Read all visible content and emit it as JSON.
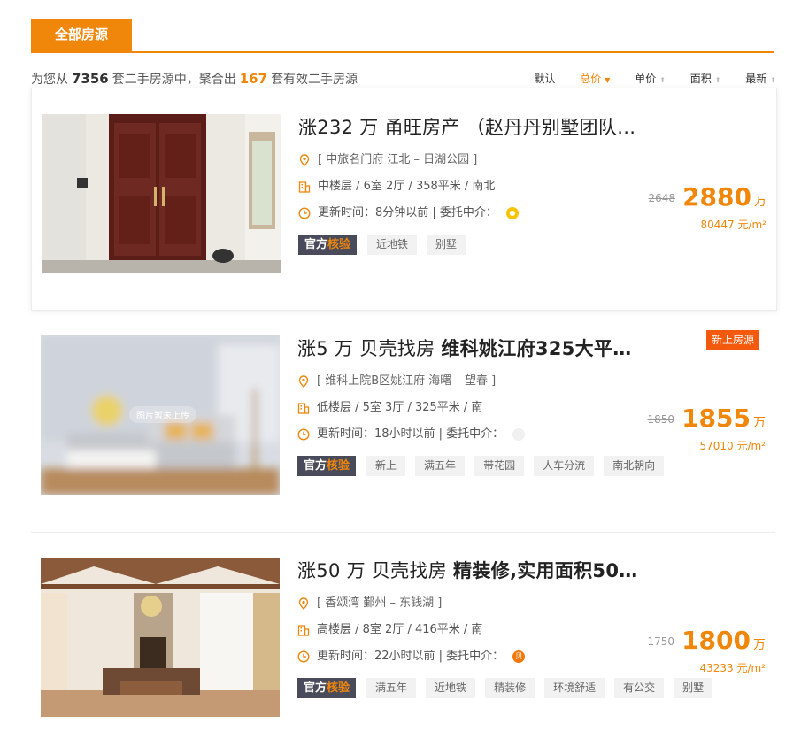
{
  "tabs": {
    "active": "全部房源"
  },
  "summary": {
    "prefix": "为您从",
    "total": "7356",
    "mid": "套二手房源中，聚合出",
    "matched": "167",
    "suffix": "套有效二手房源"
  },
  "sorts": [
    "默认",
    "总价",
    "单价",
    "面积",
    "最新"
  ],
  "colors": {
    "accent": "#f0870b",
    "new_badge": "#f35a0d"
  },
  "listings": [
    {
      "title_prefix": "涨232 万  甬旺房产 ",
      "title_main": "（赵丹丹别墅团队…",
      "address": "[ 中旅名门府 江北 – 日湖公园 ]",
      "specs": "中楼层 / 6室 2厅 / 358平米 / 南北",
      "updated": "更新时间：8分钟以前 | 委托中介：",
      "agent_icon": "yellow-agent-icon",
      "badge_pre": "官方",
      "badge_post": "核验",
      "tags": [
        "近地铁",
        "别墅"
      ],
      "old_price": "2648",
      "price": "2880",
      "unit": "万",
      "per_sqm": "80447 元/m²"
    },
    {
      "title_prefix": "涨5 万  贝壳找房 ",
      "title_main": "维科姚江府325大平…",
      "new_label": "新上房源",
      "address": "[ 维科上院B区姚江府 海曙 – 望春 ]",
      "specs": "低楼层 / 5室 3厅 / 325平米 / 南",
      "updated": "更新时间：18小时以前 | 委托中介：",
      "photo_note": "图片暂未上传",
      "badge_pre": "官方",
      "badge_post": "核验",
      "tags": [
        "新上",
        "满五年",
        "带花园",
        "人车分流",
        "南北朝向"
      ],
      "old_price": "1850",
      "price": "1855",
      "unit": "万",
      "per_sqm": "57010 元/m²"
    },
    {
      "title_prefix": "涨50 万  贝壳找房 ",
      "title_main": "精装修,实用面积50…",
      "address": "[ 香颂湾 鄞州 – 东钱湖 ]",
      "specs": "高楼层 / 8室 2厅 / 416平米 / 南",
      "updated": "更新时间：22小时以前 | 委托中介：",
      "agent_icon": "orange-agent-icon",
      "agent_char": "贝",
      "badge_pre": "官方",
      "badge_post": "核验",
      "tags": [
        "满五年",
        "近地铁",
        "精装修",
        "环境舒适",
        "有公交",
        "别墅"
      ],
      "old_price": "1750",
      "price": "1800",
      "unit": "万",
      "per_sqm": "43233 元/m²"
    }
  ]
}
